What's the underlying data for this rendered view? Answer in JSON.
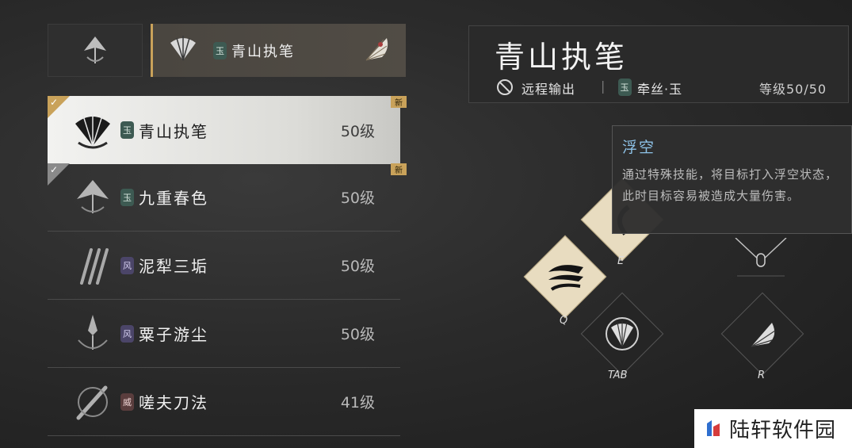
{
  "header": {
    "selected_name": "青山执笔",
    "selected_tag": "玉"
  },
  "weapon_list": [
    {
      "name": "青山执笔",
      "tag": "玉",
      "level": "50级",
      "badge": "新",
      "selected": true,
      "checked": true
    },
    {
      "name": "九重春色",
      "tag": "玉",
      "level": "50级",
      "badge": "新",
      "selected": false,
      "checked": true
    },
    {
      "name": "泥犁三垢",
      "tag": "风",
      "level": "50级"
    },
    {
      "name": "粟子游尘",
      "tag": "风",
      "level": "50级"
    },
    {
      "name": "嗟夫刀法",
      "tag": "威",
      "level": "41级"
    }
  ],
  "detail": {
    "title": "青山执笔",
    "type_label": "远程输出",
    "separator": "|",
    "affinity_tag": "玉",
    "affinity_label": "牵丝·玉",
    "level_label": "等级50/50"
  },
  "tooltip": {
    "title": "浮空",
    "body": "通过特殊技能，将目标打入浮空状态，此时目标容易被造成大量伤害。"
  },
  "skills": {
    "q_key": "Q",
    "e_key": "E",
    "tab_key": "TAB",
    "r_key": "R"
  },
  "watermark": {
    "text": "陆轩软件园"
  },
  "colors": {
    "accent_gold": "#c9a25a",
    "tooltip_title": "#8ec3e8",
    "tag_jade": "#3d5a52",
    "tag_wind": "#4b4568"
  }
}
